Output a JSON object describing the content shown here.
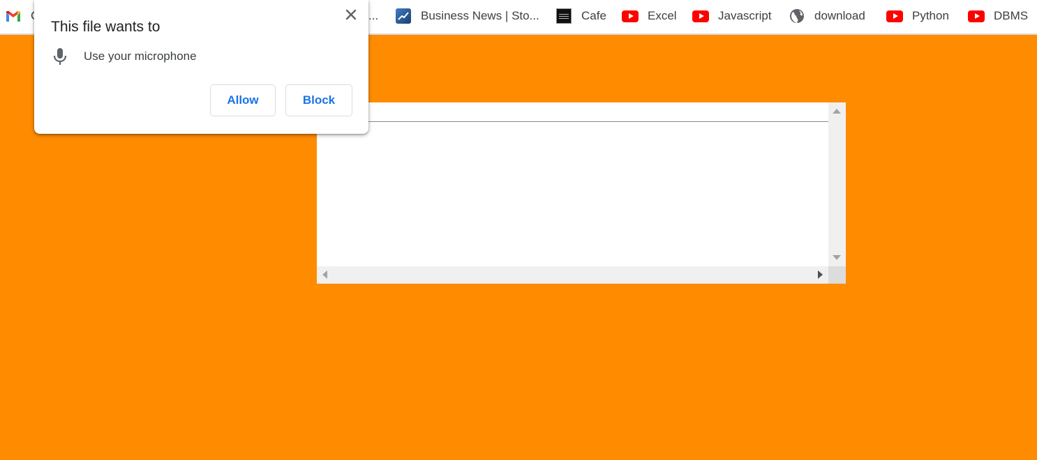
{
  "bookmarks": {
    "items": [
      {
        "label": "G",
        "icon": "gmail-icon"
      },
      {
        "label": "Business News | Sto...",
        "icon": "business-news-icon"
      },
      {
        "label": "Cafe",
        "icon": "cafe-icon"
      },
      {
        "label": "Excel",
        "icon": "youtube-icon"
      },
      {
        "label": "Javascript",
        "icon": "youtube-icon"
      },
      {
        "label": "download",
        "icon": "globe-icon"
      },
      {
        "label": "Python",
        "icon": "youtube-icon"
      },
      {
        "label": "DBMS",
        "icon": "youtube-icon"
      }
    ],
    "truncated_fragment": "..."
  },
  "popup": {
    "title": "This file wants to",
    "permission_text": "Use your microphone",
    "permission_icon": "microphone-icon",
    "allow_label": "Allow",
    "block_label": "Block",
    "close_icon": "close-icon"
  },
  "colors": {
    "page_background": "#ff8c00",
    "button_text": "#1a73e8",
    "youtube_red": "#ff0000"
  }
}
